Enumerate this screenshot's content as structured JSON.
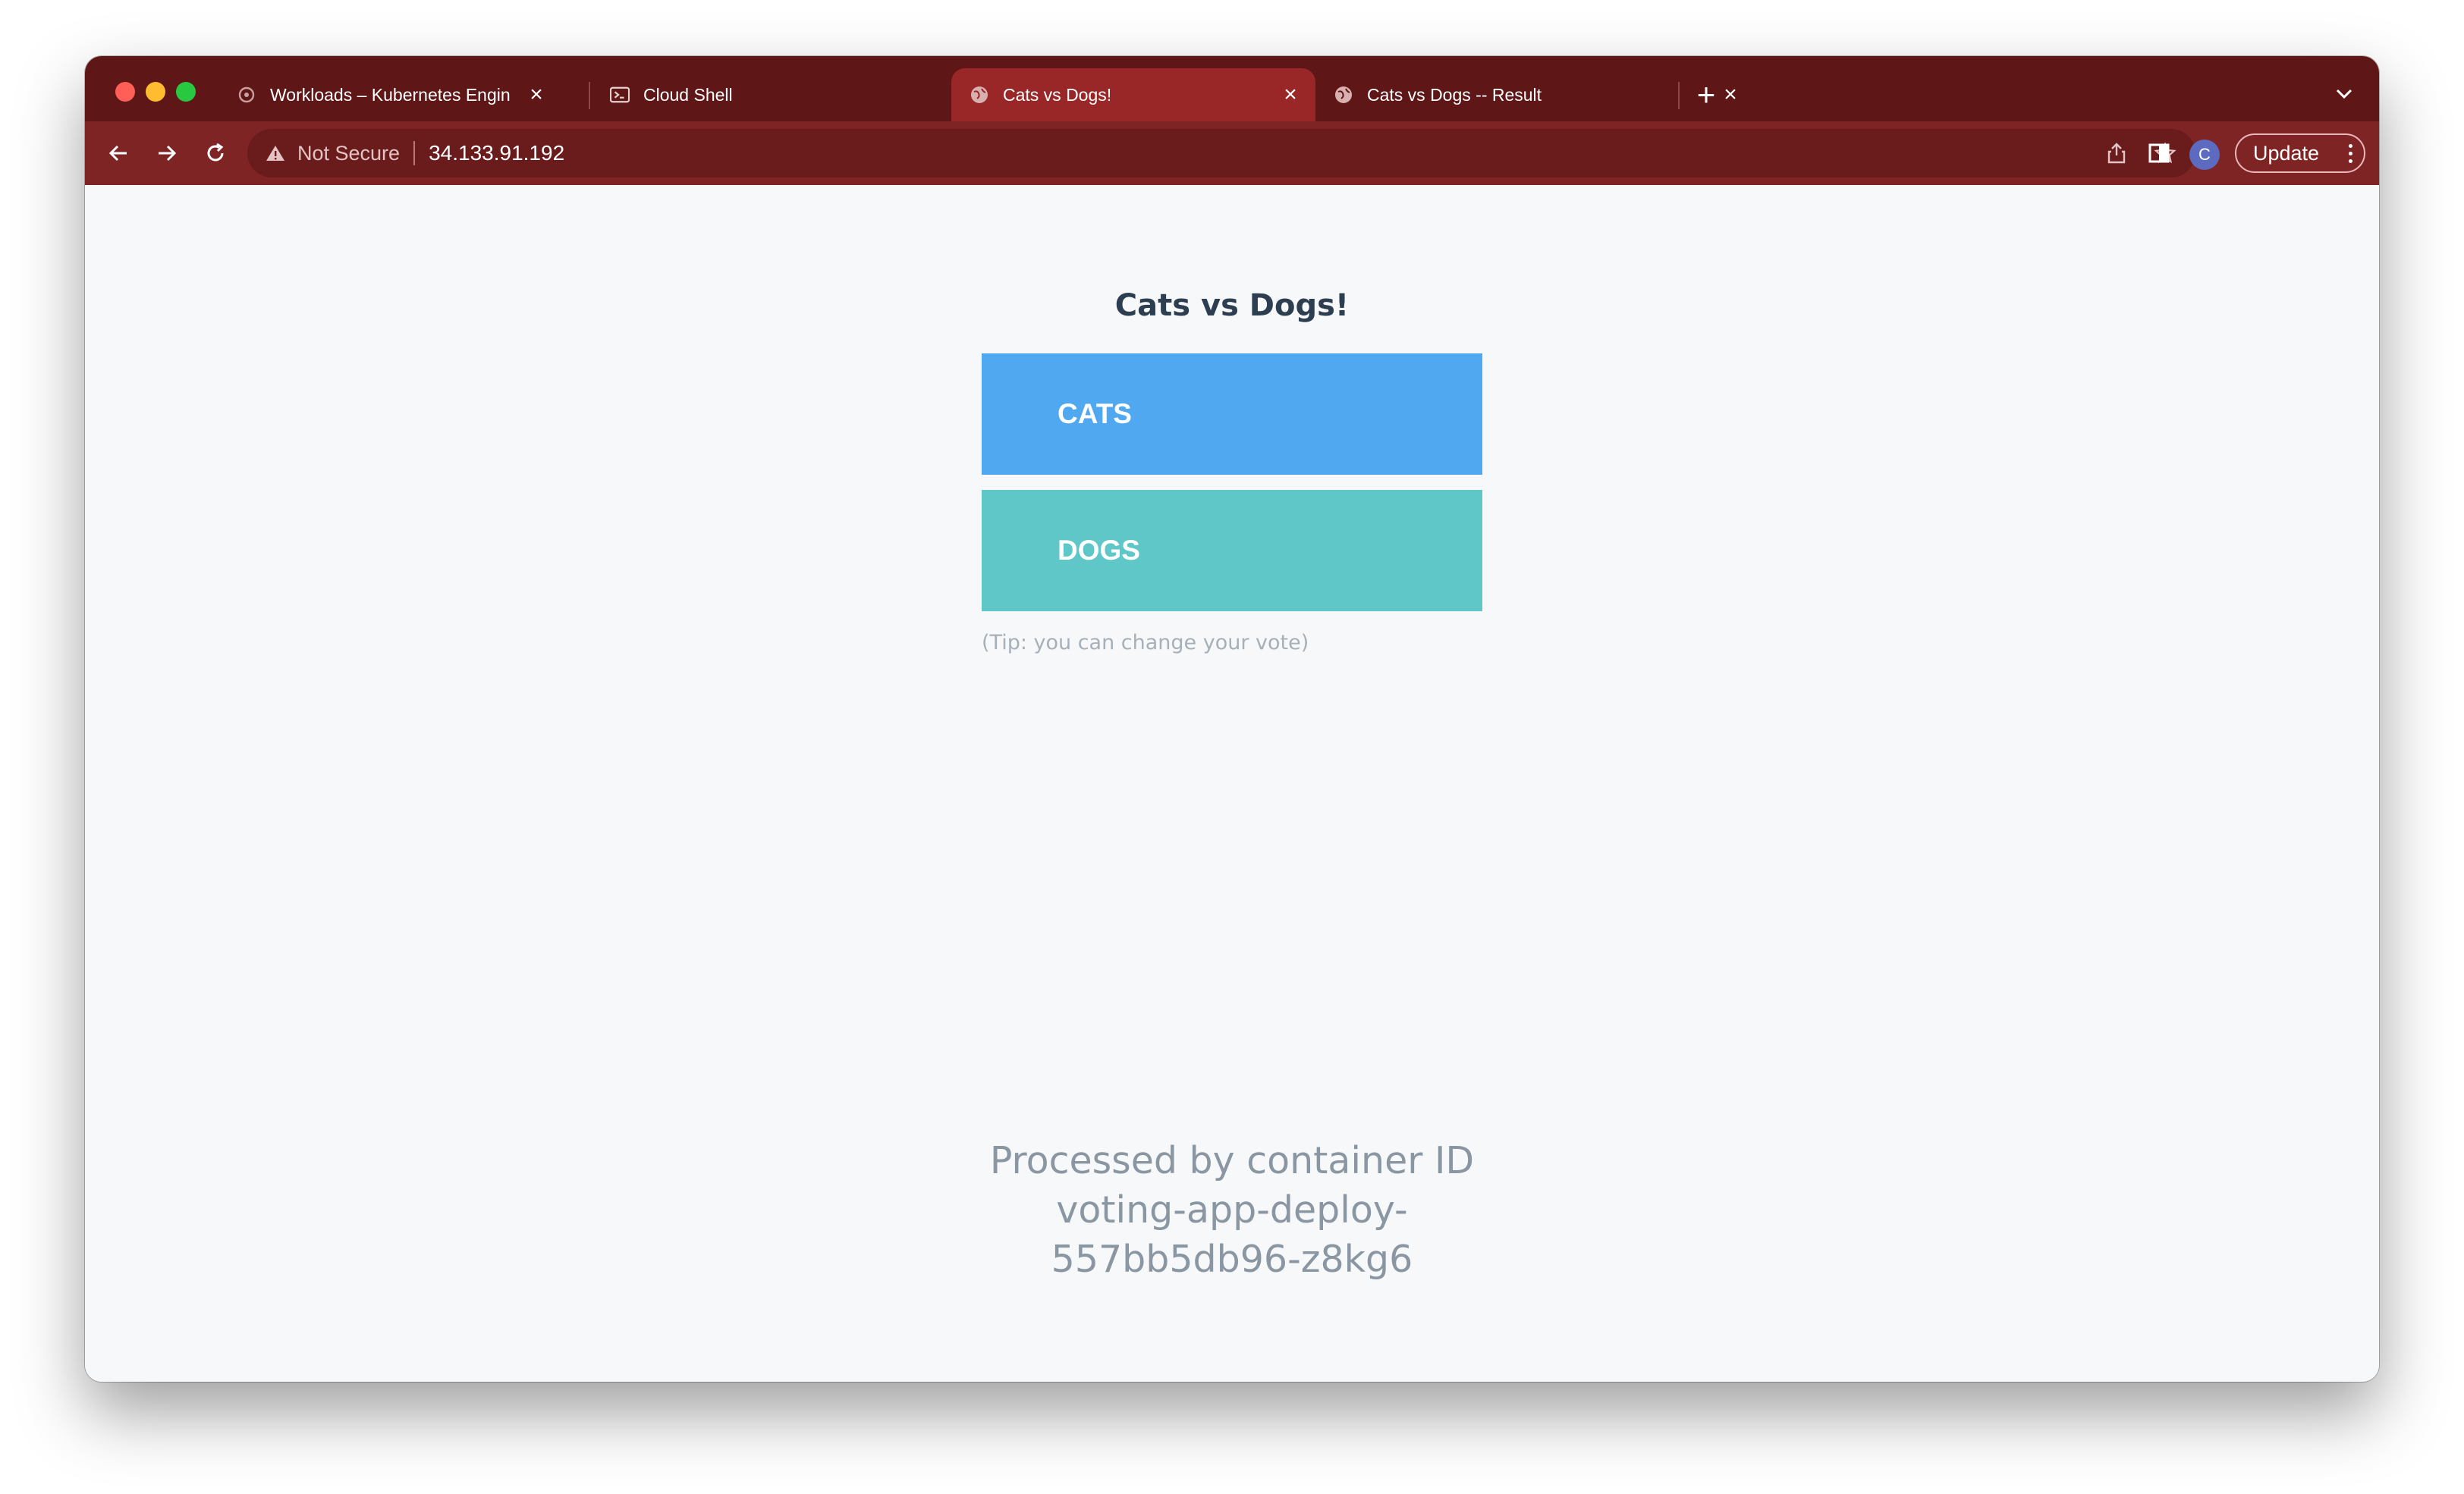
{
  "browser": {
    "tabs": [
      {
        "title": "Workloads – Kubernetes Engin",
        "active": false,
        "favicon": "kubernetes-icon"
      },
      {
        "title": "Cloud Shell",
        "active": false,
        "favicon": "terminal-icon"
      },
      {
        "title": "Cats vs Dogs!",
        "active": true,
        "favicon": "globe-icon"
      },
      {
        "title": "Cats vs Dogs -- Result",
        "active": false,
        "favicon": "globe-icon"
      }
    ],
    "address_bar": {
      "security_label": "Not Secure",
      "url": "34.133.91.192"
    },
    "profile_initial": "C",
    "update_label": "Update",
    "theme_color": "#7e2424"
  },
  "page": {
    "title": "Cats vs Dogs!",
    "options": [
      {
        "label": "CATS",
        "color": "#4fa8f0"
      },
      {
        "label": "DOGS",
        "color": "#5fc7c8"
      }
    ],
    "tip": "(Tip: you can change your vote)",
    "footer_lines": [
      "Processed by container ID",
      "voting-app-deploy-",
      "557bb5db96-z8kg6"
    ]
  }
}
